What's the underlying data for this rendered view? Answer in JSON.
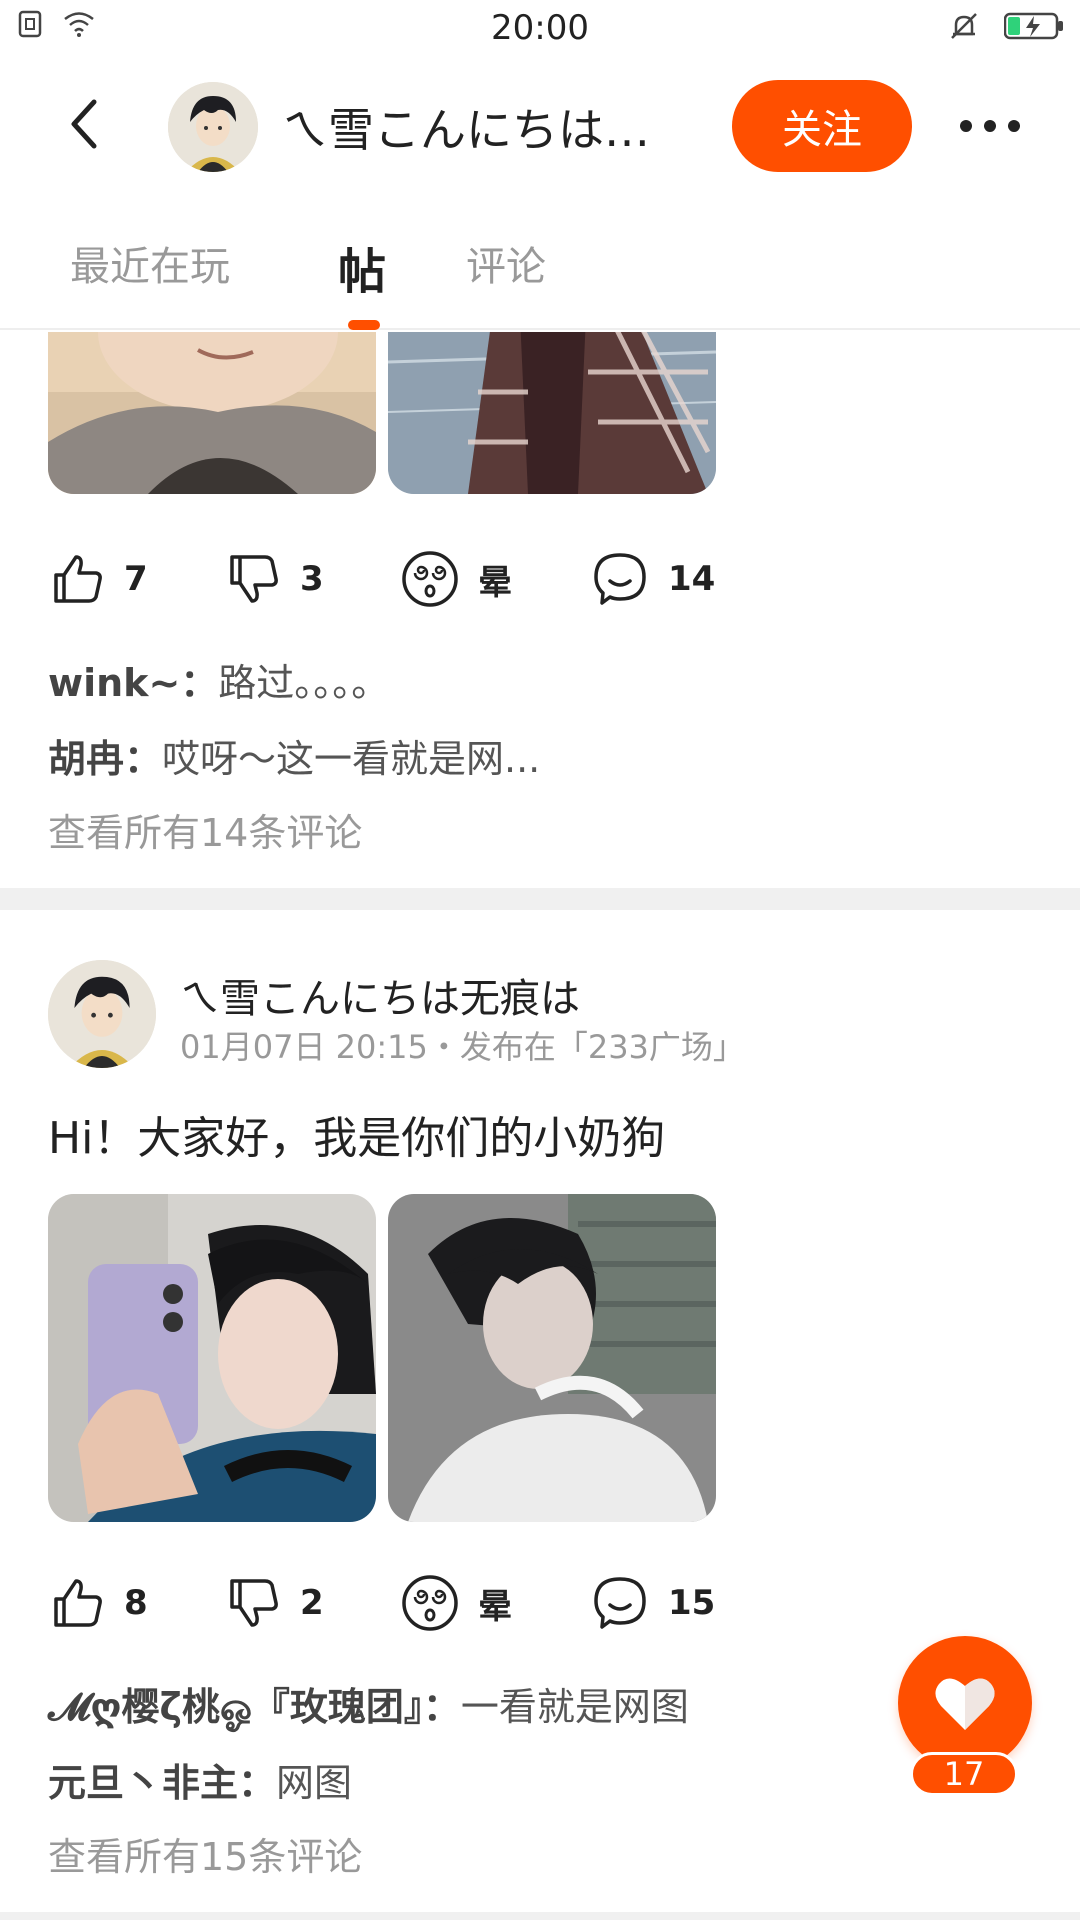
{
  "status_bar": {
    "time": "20:00"
  },
  "header": {
    "title": "ㄟ雪こんにちは无痕は",
    "follow_label": "关注"
  },
  "tabs": [
    {
      "label": "最近在玩"
    },
    {
      "label": "帖"
    },
    {
      "label": "评论"
    }
  ],
  "post1": {
    "likes": "7",
    "dislikes": "3",
    "dizzy_label": "晕",
    "comment_count": "14",
    "comments": [
      {
        "author": "wink~：",
        "text": "路过。。。。"
      },
      {
        "author": "胡冉：",
        "text": "哎呀～这一看就是网..."
      }
    ],
    "view_all": "查看所有14条评论"
  },
  "post2": {
    "author": "ㄟ雪こんにちは无痕は",
    "meta": "01月07日 20:15・发布在「233广场」",
    "text": "Hi！大家好，我是你们的小奶狗",
    "likes": "8",
    "dislikes": "2",
    "dizzy_label": "晕",
    "comment_count": "15",
    "comments": [
      {
        "author": "𝓜ღ樱ζ桃ஓ『玫瑰团』：",
        "text": "一看就是网图"
      },
      {
        "author": "元旦丶非主：",
        "text": "网图"
      }
    ],
    "view_all": "查看所有15条评论"
  },
  "fab": {
    "count": "17"
  },
  "colors": {
    "accent": "#ff4f00",
    "muted": "#999999",
    "divider": "#f0f0f0"
  }
}
